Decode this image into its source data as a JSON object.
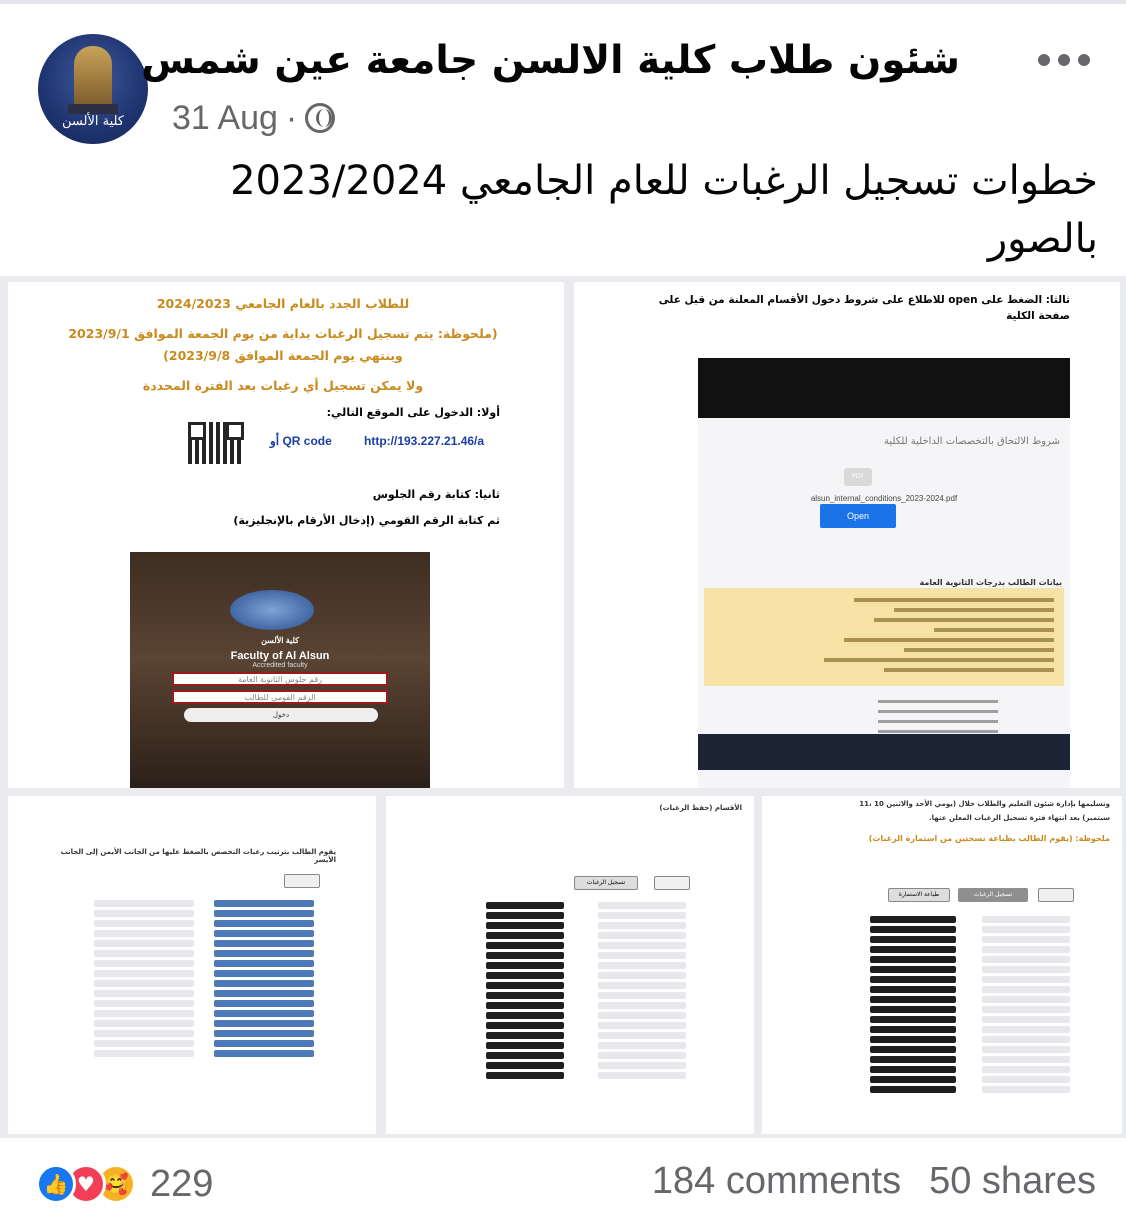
{
  "post": {
    "page_name": "شئون طلاب كلية الالسن جامعة عين شمس",
    "avatar_text": "كلية الألسن",
    "date": "31 Aug",
    "separator": "·",
    "caption_line1": "خطوات تسجيل الرغبات للعام الجامعي 2023/2024",
    "caption_line2": "بالصور"
  },
  "photo1": {
    "heading": "للطلاب الجدد بالعام الجامعي 2024/2023",
    "note1": "(ملحوظة: يتم تسجيل الرغبات بداية من يوم الجمعة الموافق 2023/9/1",
    "note2": "وينتهي يوم الجمعة الموافق 2023/9/8)",
    "note3": "ولا يمكن تسجيل أي رغبات بعد الفترة المحددة",
    "step1": "أولا: الدخول على الموقع التالي:",
    "link": "http://193.227.21.46/a",
    "or_qr": "QR code أو",
    "step2": "ثانيا: كتابة رقم الجلوس",
    "step3": "ثم كتابة الرقم القومي (إدخال الأرقام بالإنجليزية)",
    "site_label": "كلية الألسن",
    "site_title": "Faculty of Al Alsun",
    "site_sub": "Accredited faculty",
    "field1": "رقم جلوس الثانوية العامة",
    "field2": "الرقم القومي للطالب",
    "login": "دخول"
  },
  "photo2": {
    "instruction": "ثالثا: الضغط على open للاطلاع على شروط دخول الأقسام المعلنة من قبل على صفحة الكلية",
    "conditions": "شروط الالتحاق بالتخصصات الداخلية للكلية",
    "pdf": "PDF",
    "filename": "alsun_internal_conditions_2023-2024.pdf",
    "open_button": "Open",
    "data_title": "بيانات الطالب بدرجات الثانوية العامة"
  },
  "photo3": {
    "note": "يقوم الطالب بترتيب رغبات التخصص بالضغط عليها من الجانب الأيمن إلى الجانب الأيسر"
  },
  "photo4": {
    "top_text": "الأقسام (حفظ الرغبات)",
    "save_button": "تسجيل الرغبات"
  },
  "photo5": {
    "line1": "وتسليمها بإدارة شئون التعليم والطلاب خلال (يومي الأحد والاثنين 10 ،11",
    "line2": "سبتمبر) بعد انتهاء فترة تسجيل الرغبات المعلن عنها.",
    "note": "ملحوظة: (يقوم الطالب بطباعة نسختين من استمارة الرغبات)",
    "save_button": "تسجيل الرغبات",
    "print_button": "طباعة الاستمارة"
  },
  "footer": {
    "reaction_count": "229",
    "comments": "184 comments",
    "shares": "50 shares"
  },
  "colors": {
    "accent_blue": "#1877f2",
    "love_red": "#f33e58",
    "care_yellow": "#f7b125",
    "meta_gray": "#65676b",
    "note_orange": "#c98a1e"
  },
  "icons": [
    "more-icon",
    "globe-icon",
    "like-icon",
    "love-icon",
    "care-icon",
    "refresh-icon",
    "qr-code-icon",
    "pdf-icon"
  ]
}
